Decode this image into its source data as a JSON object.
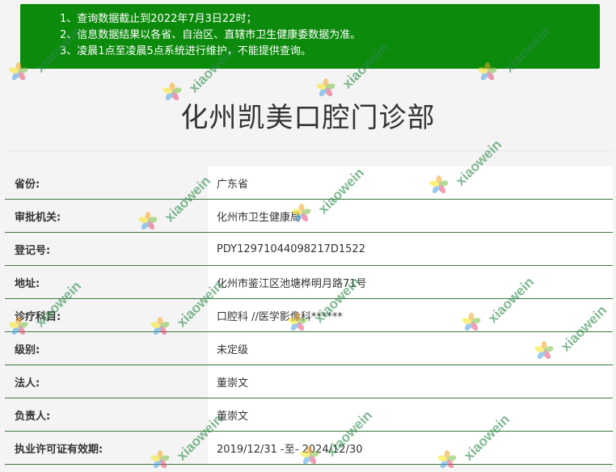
{
  "notice": {
    "lines": [
      "1、查询数据截止到2022年7月3日22时；",
      "2、信息数据结果以各省、自治区、直辖市卫生健康委数据为准。",
      "3、凌晨1点至凌晨5点系统进行维护，不能提供查询。"
    ]
  },
  "clinic": {
    "name": "化州凯美口腔门诊部"
  },
  "details": [
    {
      "label": "省份:",
      "value": "广东省"
    },
    {
      "label": "审批机关:",
      "value": "化州市卫生健康局"
    },
    {
      "label": "登记号:",
      "value": "PDY12971044098217D1522"
    },
    {
      "label": "地址:",
      "value": "化州市鉴江区池塘桦明月路71号"
    },
    {
      "label": "诊疗科目:",
      "value": "口腔科 //医学影像科******"
    },
    {
      "label": "级别:",
      "value": "未定级"
    },
    {
      "label": "法人:",
      "value": "董崇文"
    },
    {
      "label": "负责人:",
      "value": "董崇文"
    },
    {
      "label": "执业许可证有效期:",
      "value": "2019/12/31 -至- 2024/12/30"
    }
  ],
  "watermark": {
    "text": "xiaowein"
  },
  "colors": {
    "notice_bg": "#0c8a0c",
    "row_border": "#3b7a3b",
    "watermark": "#2d8a4a"
  }
}
